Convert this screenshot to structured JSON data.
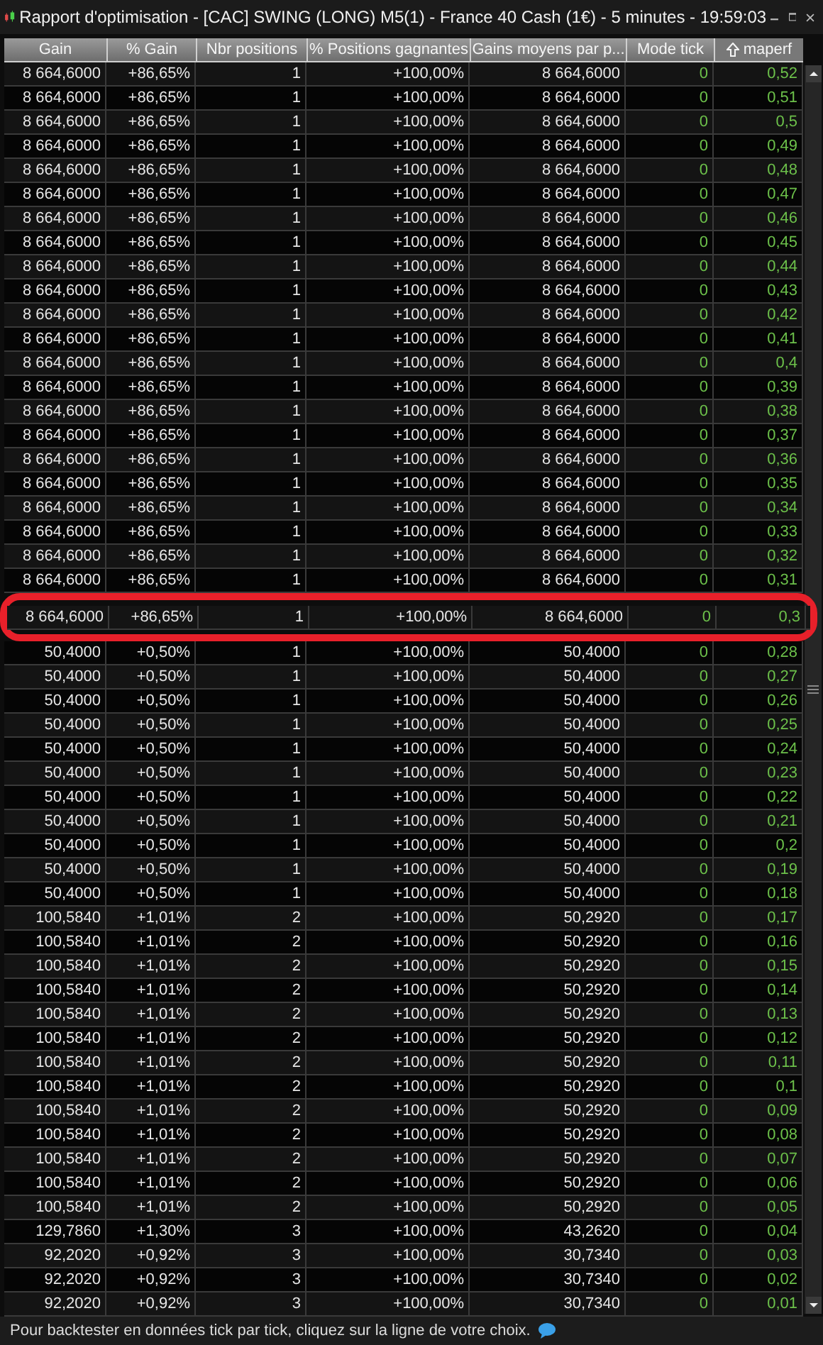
{
  "window": {
    "title": "Rapport d'optimisation - [CAC] SWING (LONG) M5(1) - France 40 Cash (1€) - 5 minutes - 19:59:03"
  },
  "table": {
    "columns": [
      {
        "label": "Gain",
        "sorted": false
      },
      {
        "label": "% Gain",
        "sorted": false
      },
      {
        "label": "Nbr positions",
        "sorted": false
      },
      {
        "label": "% Positions gagnantes",
        "sorted": false
      },
      {
        "label": "Gains moyens par p...",
        "sorted": false
      },
      {
        "label": "Mode tick",
        "sorted": false
      },
      {
        "label": "maperf",
        "sorted": true
      }
    ],
    "rows": [
      {
        "cells": [
          "8 664,6000",
          "+86,65%",
          "1",
          "+100,00%",
          "8 664,6000",
          "0",
          "0,52"
        ],
        "circled": false
      },
      {
        "cells": [
          "8 664,6000",
          "+86,65%",
          "1",
          "+100,00%",
          "8 664,6000",
          "0",
          "0,51"
        ],
        "circled": false
      },
      {
        "cells": [
          "8 664,6000",
          "+86,65%",
          "1",
          "+100,00%",
          "8 664,6000",
          "0",
          "0,5"
        ],
        "circled": false
      },
      {
        "cells": [
          "8 664,6000",
          "+86,65%",
          "1",
          "+100,00%",
          "8 664,6000",
          "0",
          "0,49"
        ],
        "circled": false
      },
      {
        "cells": [
          "8 664,6000",
          "+86,65%",
          "1",
          "+100,00%",
          "8 664,6000",
          "0",
          "0,48"
        ],
        "circled": false
      },
      {
        "cells": [
          "8 664,6000",
          "+86,65%",
          "1",
          "+100,00%",
          "8 664,6000",
          "0",
          "0,47"
        ],
        "circled": false
      },
      {
        "cells": [
          "8 664,6000",
          "+86,65%",
          "1",
          "+100,00%",
          "8 664,6000",
          "0",
          "0,46"
        ],
        "circled": false
      },
      {
        "cells": [
          "8 664,6000",
          "+86,65%",
          "1",
          "+100,00%",
          "8 664,6000",
          "0",
          "0,45"
        ],
        "circled": false
      },
      {
        "cells": [
          "8 664,6000",
          "+86,65%",
          "1",
          "+100,00%",
          "8 664,6000",
          "0",
          "0,44"
        ],
        "circled": false
      },
      {
        "cells": [
          "8 664,6000",
          "+86,65%",
          "1",
          "+100,00%",
          "8 664,6000",
          "0",
          "0,43"
        ],
        "circled": false
      },
      {
        "cells": [
          "8 664,6000",
          "+86,65%",
          "1",
          "+100,00%",
          "8 664,6000",
          "0",
          "0,42"
        ],
        "circled": false
      },
      {
        "cells": [
          "8 664,6000",
          "+86,65%",
          "1",
          "+100,00%",
          "8 664,6000",
          "0",
          "0,41"
        ],
        "circled": false
      },
      {
        "cells": [
          "8 664,6000",
          "+86,65%",
          "1",
          "+100,00%",
          "8 664,6000",
          "0",
          "0,4"
        ],
        "circled": false
      },
      {
        "cells": [
          "8 664,6000",
          "+86,65%",
          "1",
          "+100,00%",
          "8 664,6000",
          "0",
          "0,39"
        ],
        "circled": false
      },
      {
        "cells": [
          "8 664,6000",
          "+86,65%",
          "1",
          "+100,00%",
          "8 664,6000",
          "0",
          "0,38"
        ],
        "circled": false
      },
      {
        "cells": [
          "8 664,6000",
          "+86,65%",
          "1",
          "+100,00%",
          "8 664,6000",
          "0",
          "0,37"
        ],
        "circled": false
      },
      {
        "cells": [
          "8 664,6000",
          "+86,65%",
          "1",
          "+100,00%",
          "8 664,6000",
          "0",
          "0,36"
        ],
        "circled": false
      },
      {
        "cells": [
          "8 664,6000",
          "+86,65%",
          "1",
          "+100,00%",
          "8 664,6000",
          "0",
          "0,35"
        ],
        "circled": false
      },
      {
        "cells": [
          "8 664,6000",
          "+86,65%",
          "1",
          "+100,00%",
          "8 664,6000",
          "0",
          "0,34"
        ],
        "circled": false
      },
      {
        "cells": [
          "8 664,6000",
          "+86,65%",
          "1",
          "+100,00%",
          "8 664,6000",
          "0",
          "0,33"
        ],
        "circled": false
      },
      {
        "cells": [
          "8 664,6000",
          "+86,65%",
          "1",
          "+100,00%",
          "8 664,6000",
          "0",
          "0,32"
        ],
        "circled": false
      },
      {
        "cells": [
          "8 664,6000",
          "+86,65%",
          "1",
          "+100,00%",
          "8 664,6000",
          "0",
          "0,31"
        ],
        "circled": false
      },
      {
        "cells": [
          "8 664,6000",
          "+86,65%",
          "1",
          "+100,00%",
          "8 664,6000",
          "0",
          "0,3"
        ],
        "circled": true
      },
      {
        "cells": [
          "50,4000",
          "+0,50%",
          "1",
          "+100,00%",
          "50,4000",
          "0",
          "0,28"
        ],
        "circled": false
      },
      {
        "cells": [
          "50,4000",
          "+0,50%",
          "1",
          "+100,00%",
          "50,4000",
          "0",
          "0,27"
        ],
        "circled": false
      },
      {
        "cells": [
          "50,4000",
          "+0,50%",
          "1",
          "+100,00%",
          "50,4000",
          "0",
          "0,26"
        ],
        "circled": false
      },
      {
        "cells": [
          "50,4000",
          "+0,50%",
          "1",
          "+100,00%",
          "50,4000",
          "0",
          "0,25"
        ],
        "circled": false
      },
      {
        "cells": [
          "50,4000",
          "+0,50%",
          "1",
          "+100,00%",
          "50,4000",
          "0",
          "0,24"
        ],
        "circled": false
      },
      {
        "cells": [
          "50,4000",
          "+0,50%",
          "1",
          "+100,00%",
          "50,4000",
          "0",
          "0,23"
        ],
        "circled": false
      },
      {
        "cells": [
          "50,4000",
          "+0,50%",
          "1",
          "+100,00%",
          "50,4000",
          "0",
          "0,22"
        ],
        "circled": false
      },
      {
        "cells": [
          "50,4000",
          "+0,50%",
          "1",
          "+100,00%",
          "50,4000",
          "0",
          "0,21"
        ],
        "circled": false
      },
      {
        "cells": [
          "50,4000",
          "+0,50%",
          "1",
          "+100,00%",
          "50,4000",
          "0",
          "0,2"
        ],
        "circled": false
      },
      {
        "cells": [
          "50,4000",
          "+0,50%",
          "1",
          "+100,00%",
          "50,4000",
          "0",
          "0,19"
        ],
        "circled": false
      },
      {
        "cells": [
          "50,4000",
          "+0,50%",
          "1",
          "+100,00%",
          "50,4000",
          "0",
          "0,18"
        ],
        "circled": false
      },
      {
        "cells": [
          "100,5840",
          "+1,01%",
          "2",
          "+100,00%",
          "50,2920",
          "0",
          "0,17"
        ],
        "circled": false
      },
      {
        "cells": [
          "100,5840",
          "+1,01%",
          "2",
          "+100,00%",
          "50,2920",
          "0",
          "0,16"
        ],
        "circled": false
      },
      {
        "cells": [
          "100,5840",
          "+1,01%",
          "2",
          "+100,00%",
          "50,2920",
          "0",
          "0,15"
        ],
        "circled": false
      },
      {
        "cells": [
          "100,5840",
          "+1,01%",
          "2",
          "+100,00%",
          "50,2920",
          "0",
          "0,14"
        ],
        "circled": false
      },
      {
        "cells": [
          "100,5840",
          "+1,01%",
          "2",
          "+100,00%",
          "50,2920",
          "0",
          "0,13"
        ],
        "circled": false
      },
      {
        "cells": [
          "100,5840",
          "+1,01%",
          "2",
          "+100,00%",
          "50,2920",
          "0",
          "0,12"
        ],
        "circled": false
      },
      {
        "cells": [
          "100,5840",
          "+1,01%",
          "2",
          "+100,00%",
          "50,2920",
          "0",
          "0,11"
        ],
        "circled": false
      },
      {
        "cells": [
          "100,5840",
          "+1,01%",
          "2",
          "+100,00%",
          "50,2920",
          "0",
          "0,1"
        ],
        "circled": false
      },
      {
        "cells": [
          "100,5840",
          "+1,01%",
          "2",
          "+100,00%",
          "50,2920",
          "0",
          "0,09"
        ],
        "circled": false
      },
      {
        "cells": [
          "100,5840",
          "+1,01%",
          "2",
          "+100,00%",
          "50,2920",
          "0",
          "0,08"
        ],
        "circled": false
      },
      {
        "cells": [
          "100,5840",
          "+1,01%",
          "2",
          "+100,00%",
          "50,2920",
          "0",
          "0,07"
        ],
        "circled": false
      },
      {
        "cells": [
          "100,5840",
          "+1,01%",
          "2",
          "+100,00%",
          "50,2920",
          "0",
          "0,06"
        ],
        "circled": false
      },
      {
        "cells": [
          "100,5840",
          "+1,01%",
          "2",
          "+100,00%",
          "50,2920",
          "0",
          "0,05"
        ],
        "circled": false
      },
      {
        "cells": [
          "129,7860",
          "+1,30%",
          "3",
          "+100,00%",
          "43,2620",
          "0",
          "0,04"
        ],
        "circled": false
      },
      {
        "cells": [
          "92,2020",
          "+0,92%",
          "3",
          "+100,00%",
          "30,7340",
          "0",
          "0,03"
        ],
        "circled": false
      },
      {
        "cells": [
          "92,2020",
          "+0,92%",
          "3",
          "+100,00%",
          "30,7340",
          "0",
          "0,02"
        ],
        "circled": false
      },
      {
        "cells": [
          "92,2020",
          "+0,92%",
          "3",
          "+100,00%",
          "30,7340",
          "0",
          "0,01"
        ],
        "circled": false
      }
    ]
  },
  "status_bar": {
    "text": "Pour backtester en données tick par tick, cliquez sur la ligne de votre choix."
  }
}
